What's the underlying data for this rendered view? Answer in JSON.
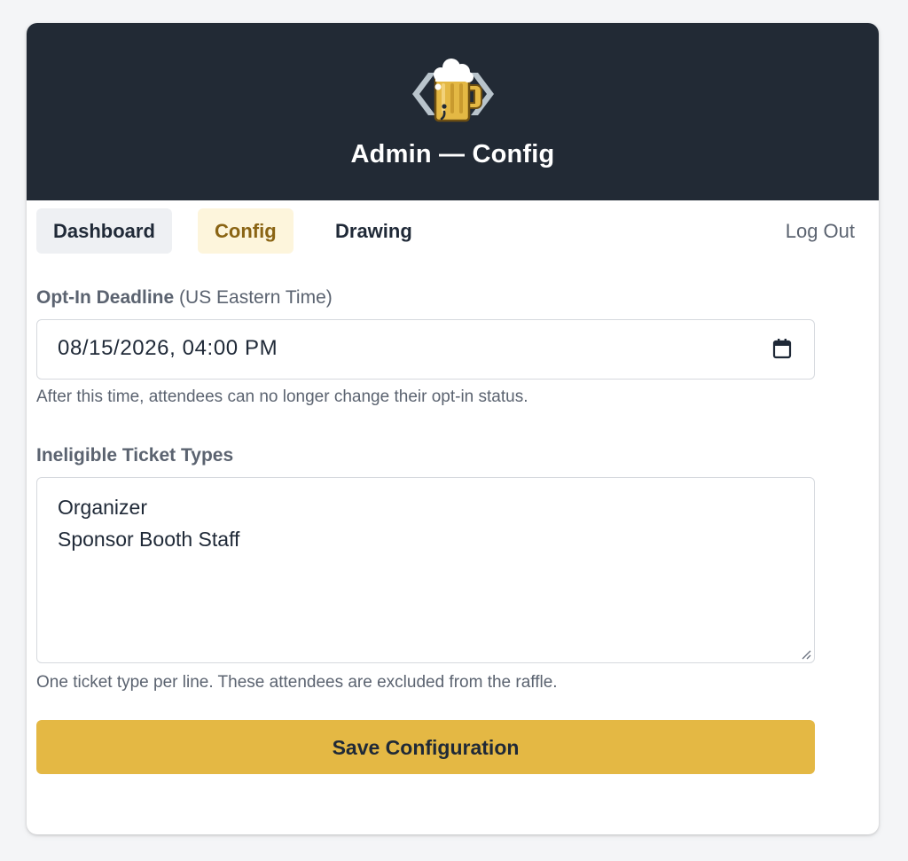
{
  "header": {
    "title": "Admin — Config",
    "logo_icon": "beer-mug-code-logo"
  },
  "nav": {
    "tabs": [
      {
        "label": "Dashboard",
        "active": false
      },
      {
        "label": "Config",
        "active": true
      },
      {
        "label": "Drawing",
        "active": false
      }
    ],
    "logout_label": "Log Out"
  },
  "form": {
    "deadline": {
      "label": "Opt-In Deadline",
      "label_suffix": "(US Eastern Time)",
      "value": "08/15/2026, 04:00 PM",
      "help": "After this time, attendees can no longer change their opt-in status.",
      "icon": "calendar-icon"
    },
    "ineligible": {
      "label": "Ineligible Ticket Types",
      "lines": [
        "Organizer",
        "Sponsor Booth Staff"
      ],
      "help": "One ticket type per line. These attendees are excluded from the raffle."
    },
    "save_label": "Save Configuration"
  },
  "colors": {
    "header_bg": "#222a35",
    "accent": "#e4b844",
    "active_tab_bg": "#fdf5dc",
    "active_tab_text": "#8a6414"
  }
}
